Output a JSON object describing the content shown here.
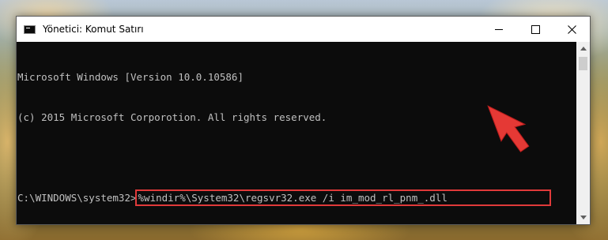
{
  "window": {
    "title": "Yönetici: Komut Satırı",
    "controls": {
      "minimize": "minimize-icon",
      "maximize": "maximize-icon",
      "close": "close-icon"
    }
  },
  "console": {
    "line1": "Microsoft Windows [Version 10.0.10586]",
    "line2": "(c) 2015 Microsoft Corporotion. All rights reserved.",
    "line3": "",
    "prompt": "C:\\WINDOWS\\system32>",
    "command": "%windir%\\System32\\regsvr32.exe /i im_mod_rl_pnm_.dll"
  },
  "colors": {
    "highlight": "#e03a3a",
    "arrow": "#e53935",
    "console_bg": "#0c0c0c",
    "console_text": "#c0c0c0"
  },
  "annotation": {
    "arrow_icon": "red-arrow-icon"
  }
}
